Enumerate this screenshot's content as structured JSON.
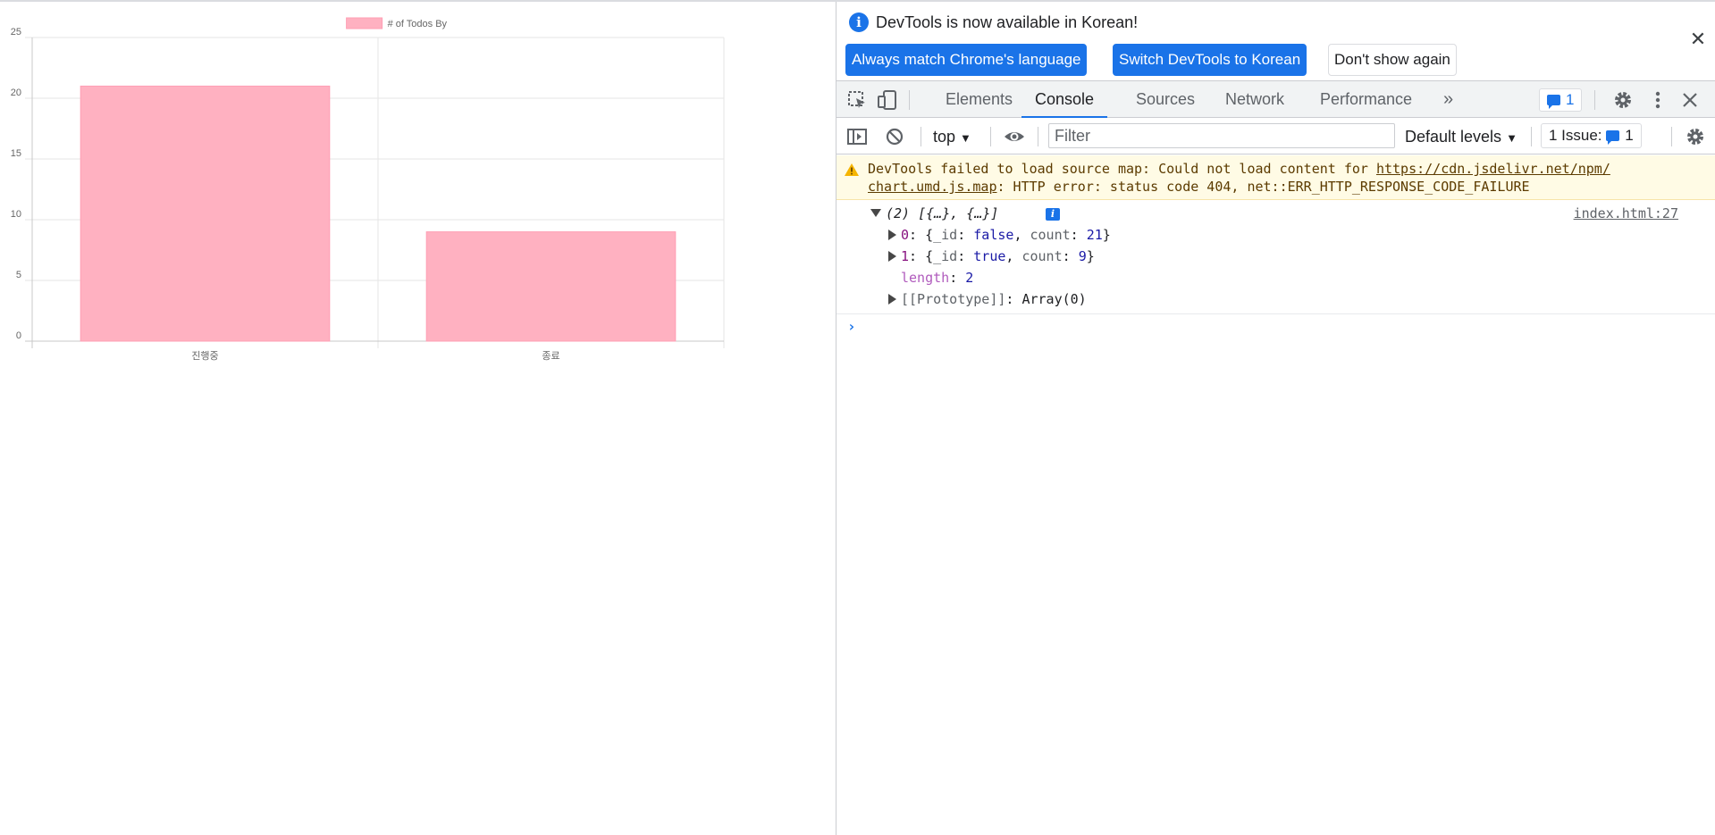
{
  "chart_data": {
    "type": "bar",
    "categories": [
      "진행중",
      "종료"
    ],
    "series": [
      {
        "name": "# of Todos By",
        "values": [
          21,
          9
        ]
      }
    ],
    "ylim": [
      0,
      25
    ],
    "yticks": [
      0,
      5,
      10,
      15,
      20,
      25
    ],
    "grid": true,
    "legend": "top",
    "colors": {
      "bar_fill": "#ffb1c1",
      "bar_border": "#ff9fb4",
      "grid": "#e6e6e6",
      "axis": "#c8c8c8"
    }
  },
  "devtools": {
    "infobar": {
      "message": "DevTools is now available in Korean!",
      "buttons": {
        "always_match": "Always match Chrome's language",
        "switch": "Switch DevTools to Korean",
        "dont_show": "Don't show again"
      },
      "close_icon": "close-icon"
    },
    "tabs": [
      "Elements",
      "Console",
      "Sources",
      "Network",
      "Performance"
    ],
    "active_tab": "Console",
    "message_count": "1",
    "filterbar": {
      "context": "top",
      "filter_placeholder": "Filter",
      "levels": "Default levels",
      "issues_label": "1 Issue:",
      "issues_count": "1"
    },
    "console": {
      "warning": {
        "prefix": "DevTools failed to load source map: Could not load content for ",
        "url_part1": "https://cdn.jsdelivr.net/npm/",
        "url_part2": "chart.umd.js.map",
        "suffix": ": HTTP error: status code 404, net::ERR_HTTP_RESPONSE_CODE_FAILURE"
      },
      "log": {
        "summary": "(2) [{…}, {…}]",
        "source": "index.html:27",
        "items": [
          {
            "index": "0",
            "id_value": "false",
            "count_value": "21"
          },
          {
            "index": "1",
            "id_value": "true",
            "count_value": "9"
          }
        ],
        "length_key": "length",
        "length_value": "2",
        "prototype_key": "[[Prototype]]",
        "prototype_value": "Array(0)"
      }
    }
  }
}
